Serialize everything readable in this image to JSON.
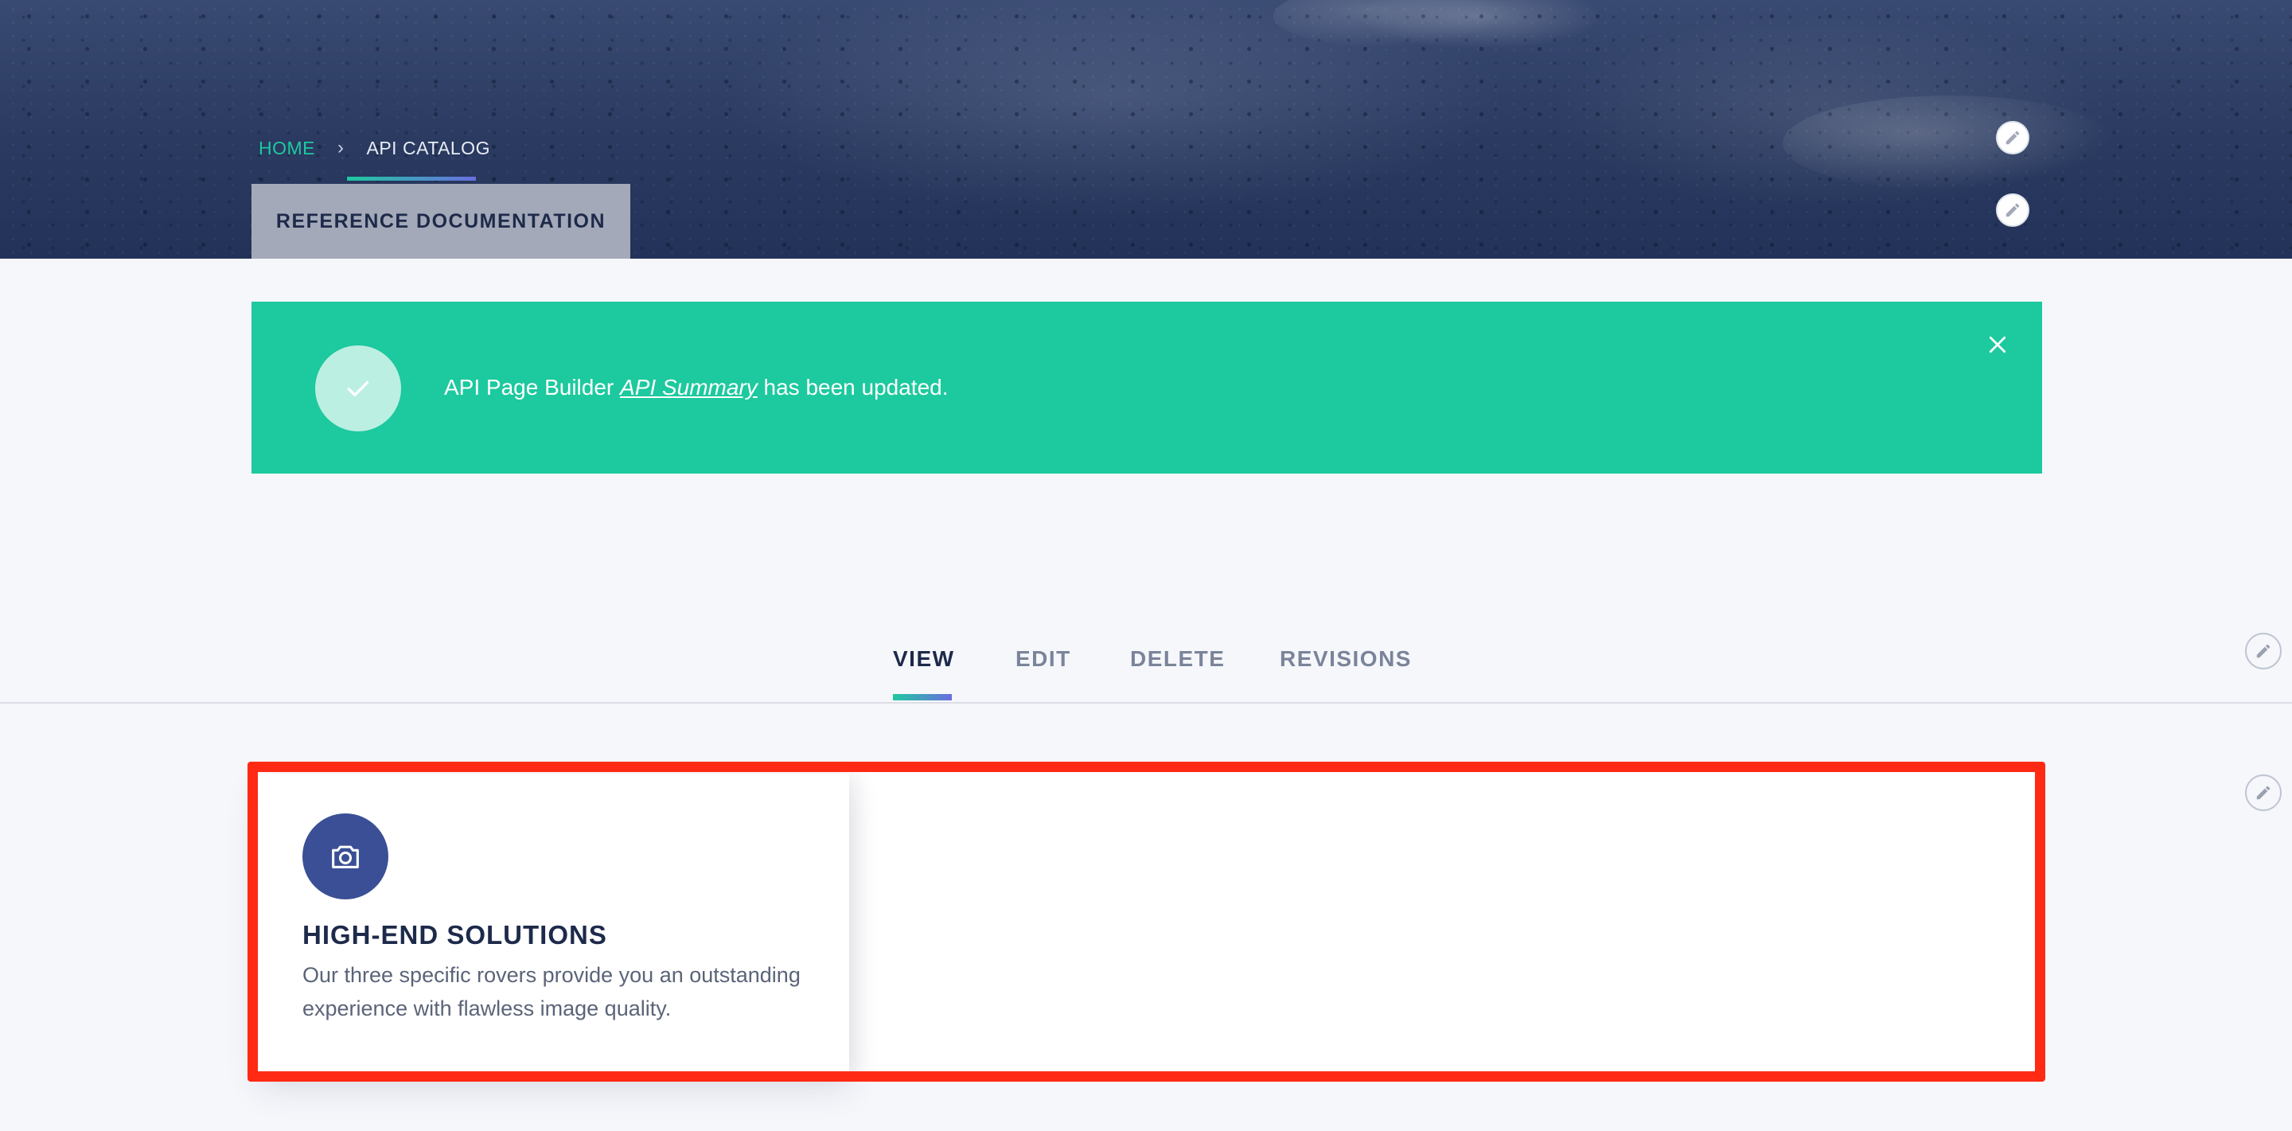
{
  "breadcrumb": {
    "home": "HOME",
    "separator": "›",
    "current": "API CATALOG"
  },
  "reference_tab": {
    "label": "REFERENCE DOCUMENTATION"
  },
  "alert": {
    "prefix": "API Page Builder ",
    "link": "API Summary",
    "suffix": " has been updated.",
    "icon": "check-icon",
    "close_icon": "close-icon",
    "color": "#1dc99e"
  },
  "tabs": [
    {
      "label": "VIEW",
      "active": true
    },
    {
      "label": "EDIT",
      "active": false
    },
    {
      "label": "DELETE",
      "active": false
    },
    {
      "label": "REVISIONS",
      "active": false
    }
  ],
  "card": {
    "icon": "camera-icon",
    "title": "HIGH-END SOLUTIONS",
    "description": "Our three specific rovers provide you an outstanding experience with flawless image quality."
  },
  "colors": {
    "accent_green": "#1fc9a0",
    "accent_purple": "#6a6ee0",
    "navy": "#1d2a4a",
    "card_icon_bg": "#3b4f96",
    "highlight_border": "#ff2a14"
  }
}
